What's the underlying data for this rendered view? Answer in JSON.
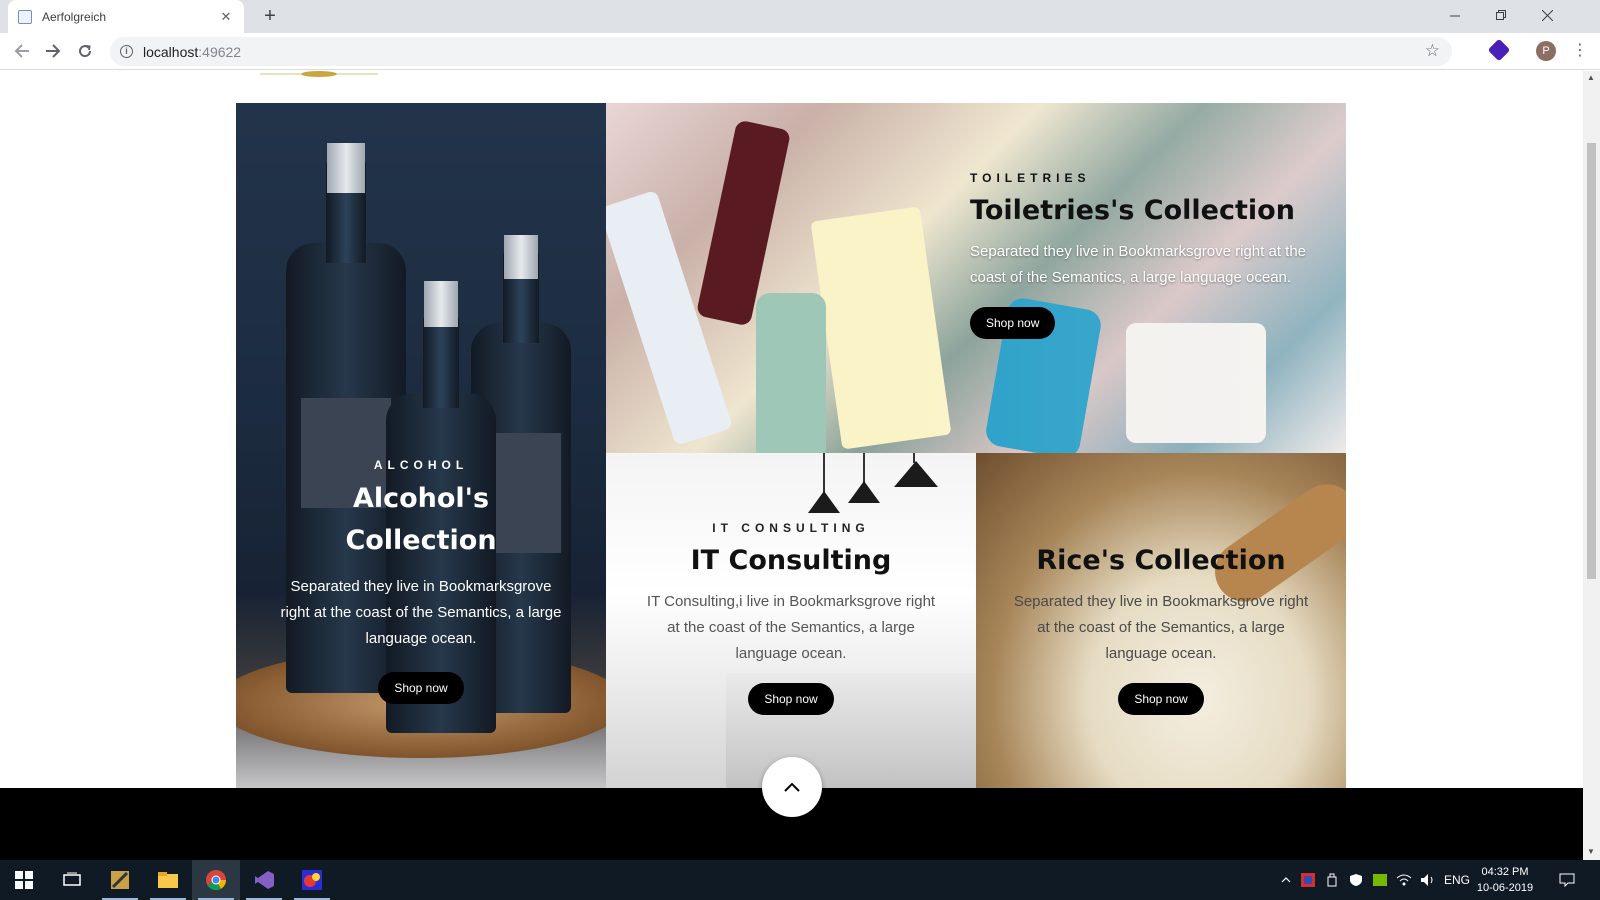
{
  "browser": {
    "tab_title": "Aerfolgreich",
    "tab_close": "✕",
    "new_tab": "+",
    "url_host": "localhost",
    "url_port": ":49622",
    "profile_initial": "P"
  },
  "tiles": {
    "alcohol": {
      "subheading": "ALCOHOL",
      "heading": "Alcohol's Collection",
      "description": "Separated they live in Bookmarksgrove right at the coast of the Semantics, a large language ocean.",
      "button": "Shop now"
    },
    "toiletries": {
      "subheading": "TOILETRIES",
      "heading": "Toiletries's Collection",
      "description": "Separated they live in Bookmarksgrove right at the coast of the Semantics, a large language ocean.",
      "button": "Shop now"
    },
    "it_consulting": {
      "subheading": "IT CONSULTING",
      "heading": "IT Consulting",
      "description": "IT Consulting,i live in Bookmarksgrove right at the coast of the Semantics, a large language ocean.",
      "button": "Shop now"
    },
    "rice": {
      "heading": "Rice's Collection",
      "description": "Separated they live in Bookmarksgrove right at the coast of the Semantics, a large language ocean.",
      "button": "Shop now"
    }
  },
  "taskbar": {
    "language": "ENG",
    "time": "04:32 PM",
    "date": "10-06-2019",
    "apps": [
      "start-icon",
      "task-view-icon",
      "tools-app-icon",
      "file-explorer-icon",
      "chrome-icon",
      "visual-studio-icon",
      "paint-app-icon"
    ]
  },
  "colors": {
    "button_bg": "#000000",
    "footer_bg": "#000000",
    "taskbar_bg": "#101a24"
  }
}
